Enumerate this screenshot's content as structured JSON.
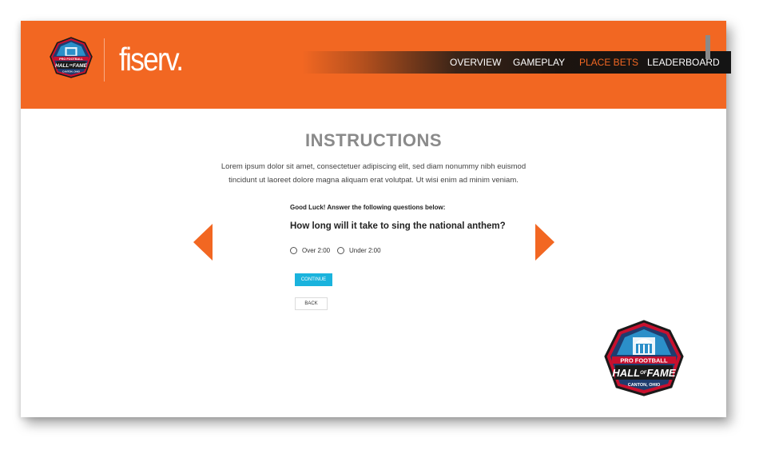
{
  "header": {
    "brand": "fiserv.",
    "logo_icon": "hall-of-fame-shield-icon",
    "accent_color": "#f26722"
  },
  "nav": {
    "items": [
      {
        "label": "OVERVIEW",
        "active": false
      },
      {
        "label": "GAMEPLAY",
        "active": false
      },
      {
        "label": "PLACE BETS",
        "active": true
      },
      {
        "label": "LEADERBOARD",
        "active": false
      }
    ]
  },
  "main": {
    "title": "INSTRUCTIONS",
    "description_line1": "Lorem ipsum dolor sit amet, consectetuer adipiscing elit, sed diam nonummy nibh euismod",
    "description_line2": "tincidunt ut laoreet dolore magna aliquam erat volutpat. Ut wisi enim ad minim veniam.",
    "good_luck": "Good Luck! Answer the following questions below:",
    "question": "How long will it take to sing the national anthem?",
    "options": [
      {
        "label": "Over 2:00",
        "selected": false
      },
      {
        "label": "Under 2:00",
        "selected": false
      }
    ],
    "continue_label": "CONTINUE",
    "back_label": "BACK",
    "continue_color": "#1ab3dd"
  },
  "logo_badge": {
    "line1": "PRO FOOTBALL",
    "line2": "HALL",
    "line2_of": "OF",
    "line2_end": "FAME",
    "line3": "CANTON, OHIO"
  }
}
